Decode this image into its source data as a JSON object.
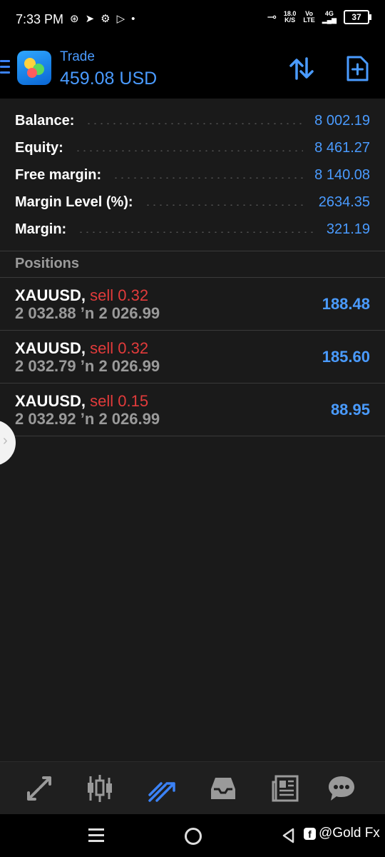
{
  "status_bar": {
    "time": "7:33 PM",
    "speed_value": "18.0",
    "speed_unit": "K/S",
    "volte": "Vo",
    "lte": "LTE",
    "network": "4G",
    "battery": "37"
  },
  "header": {
    "title": "Trade",
    "value": "459.08 USD",
    "accent_color": "#4a9bff",
    "icons": [
      "menu-icon",
      "app-logo",
      "sort-icon",
      "new-order-icon"
    ]
  },
  "summary": [
    {
      "label": "Balance:",
      "value": "8 002.19"
    },
    {
      "label": "Equity:",
      "value": "8 461.27"
    },
    {
      "label": "Free margin:",
      "value": "8 140.08"
    },
    {
      "label": "Margin Level (%):",
      "value": "2634.35"
    },
    {
      "label": "Margin:",
      "value": "321.19"
    }
  ],
  "positions": {
    "header": "Positions",
    "items": [
      {
        "symbol": "XAUUSD,",
        "side": "sell 0.32",
        "open_price": "2 032.88",
        "arrow": "’n",
        "current_price": "2 026.99",
        "profit": "188.48"
      },
      {
        "symbol": "XAUUSD,",
        "side": "sell 0.32",
        "open_price": "2 032.79",
        "arrow": "’n",
        "current_price": "2 026.99",
        "profit": "185.60"
      },
      {
        "symbol": "XAUUSD,",
        "side": "sell 0.15",
        "open_price": "2 032.92",
        "arrow": "’n",
        "current_price": "2 026.99",
        "profit": "88.95"
      }
    ]
  },
  "bottom_nav": {
    "items": [
      "quotes-icon",
      "chart-icon",
      "trade-icon",
      "history-icon",
      "news-icon",
      "chat-icon"
    ],
    "active": "trade-icon"
  },
  "watermark": {
    "text": "@Gold Fx"
  }
}
